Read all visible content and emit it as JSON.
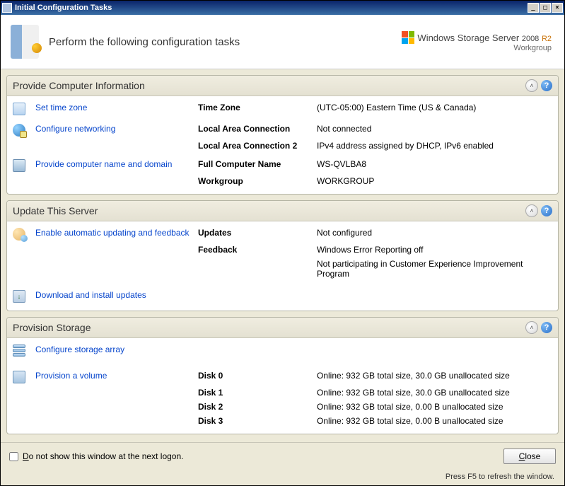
{
  "window": {
    "title": "Initial Configuration Tasks"
  },
  "header": {
    "subtitle": "Perform the following configuration tasks",
    "brand_main": "Windows Storage Server",
    "brand_year": "2008",
    "brand_r2": "R2",
    "brand_sub": "Workgroup"
  },
  "groups": {
    "info": {
      "title": "Provide Computer Information",
      "rows": [
        {
          "link": "Set time zone",
          "icon": "clock",
          "labels": [
            "Time Zone"
          ],
          "values": [
            "(UTC-05:00) Eastern Time (US & Canada)"
          ]
        },
        {
          "link": "Configure networking",
          "icon": "net",
          "labels": [
            "Local Area Connection",
            "Local Area Connection 2"
          ],
          "values": [
            "Not connected",
            "IPv4 address assigned by DHCP, IPv6 enabled"
          ]
        },
        {
          "link": "Provide computer name and domain",
          "icon": "pc",
          "labels": [
            "Full Computer Name",
            "Workgroup"
          ],
          "values": [
            "WS-QVLBA8",
            "WORKGROUP"
          ]
        }
      ]
    },
    "update": {
      "title": "Update This Server",
      "rows": [
        {
          "link": "Enable automatic updating and feedback",
          "icon": "users",
          "labels": [
            "Updates",
            "Feedback",
            ""
          ],
          "values": [
            "Not configured",
            "Windows Error Reporting off",
            "Not participating in Customer Experience Improvement Program"
          ]
        },
        {
          "link": "Download and install updates",
          "icon": "dl",
          "labels": [],
          "values": []
        }
      ]
    },
    "storage": {
      "title": "Provision Storage",
      "rows": [
        {
          "link": "Configure storage array",
          "icon": "stor",
          "labels": [],
          "values": []
        },
        {
          "link": "Provision a volume",
          "icon": "vol",
          "labels": [
            "Disk 0",
            "Disk 1",
            "Disk 2",
            "Disk 3"
          ],
          "values": [
            "Online: 932 GB total size, 30.0 GB unallocated size",
            "Online: 932 GB total size, 30.0 GB unallocated size",
            "Online: 932 GB total size, 0.00 B unallocated size",
            "Online: 932 GB total size, 0.00 B unallocated size"
          ]
        }
      ]
    }
  },
  "footer": {
    "checkbox_label_pre": "D",
    "checkbox_label": "o not show this window at the next logon.",
    "close_pre": "C",
    "close": "lose"
  },
  "status": "Press F5 to refresh the window."
}
